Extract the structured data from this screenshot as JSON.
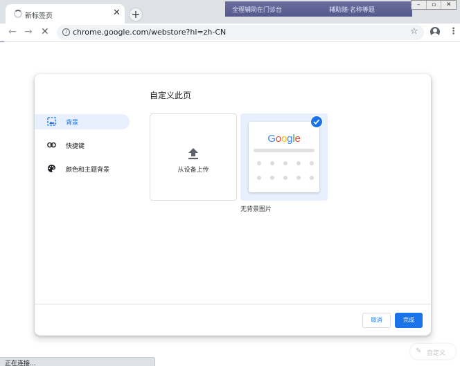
{
  "browser": {
    "tab_title": "新标签页",
    "tab_close": "✕",
    "new_tab": "+",
    "url": "chrome.google.com/webstore?hl=zh-CN",
    "background_window_text": [
      "全程辅助在门诊台",
      "辅助随·名称等题"
    ],
    "window_controls": [
      "–",
      "▫",
      "✕"
    ]
  },
  "dialog": {
    "title": "自定义此页",
    "sidebar": [
      {
        "label": "背景",
        "icon": "image-icon",
        "active": true
      },
      {
        "label": "快捷键",
        "icon": "link-icon",
        "active": false
      },
      {
        "label": "颜色和主题背景",
        "icon": "palette-icon",
        "active": false
      }
    ],
    "upload_label": "从设备上传",
    "no_background_label": "无背景图片",
    "preview_logo": "Google",
    "cancel_label": "取消",
    "done_label": "完成"
  },
  "status": {
    "text": "正在连接..."
  },
  "customize_button": {
    "label": "自定义"
  },
  "colors": {
    "accent": "#1a73e8",
    "selected_bg": "#e8f0fe",
    "titlebar": "#dee1e6"
  }
}
